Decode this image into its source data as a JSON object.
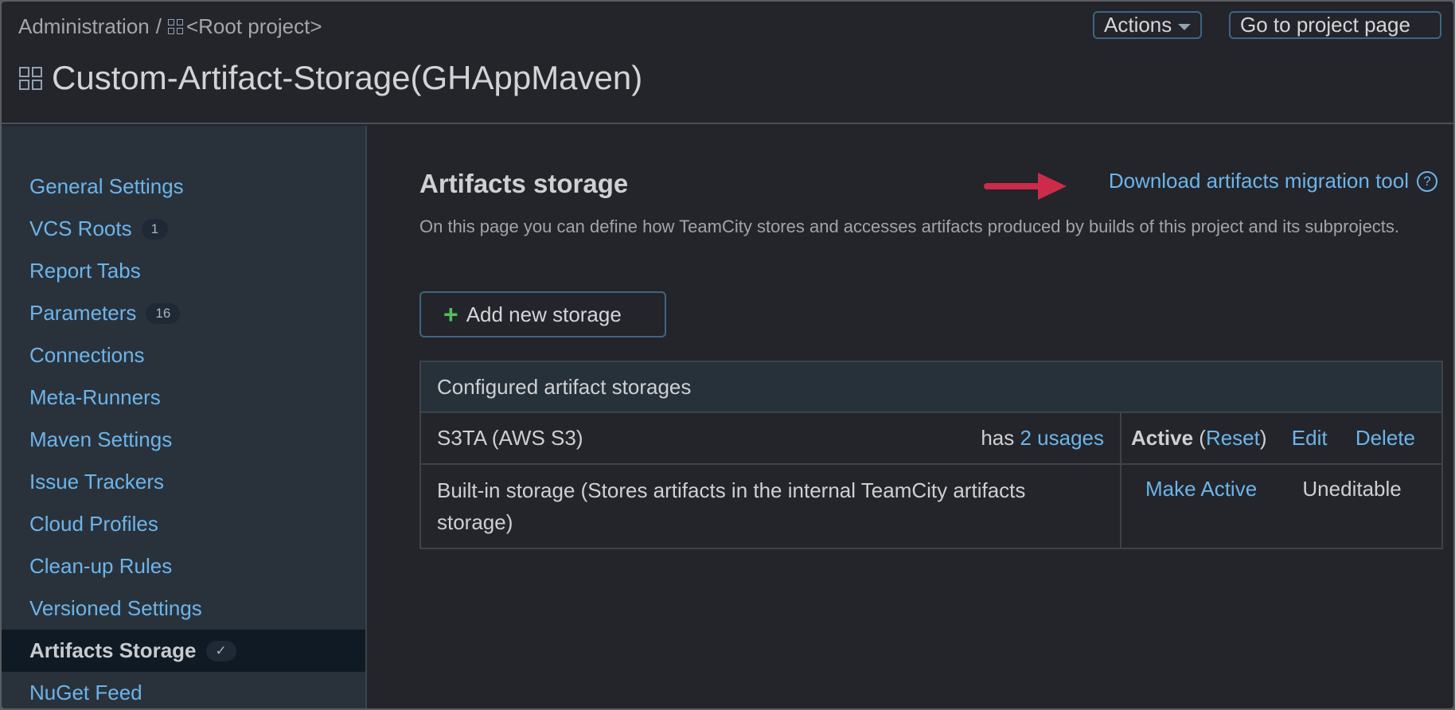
{
  "breadcrumb": {
    "admin": "Administration",
    "sep": "/",
    "root": "<Root project>"
  },
  "title": "Custom-Artifact-Storage(GHAppMaven)",
  "header_buttons": {
    "actions": "Actions",
    "go_to_project": "Go to project page"
  },
  "sidebar": {
    "items": [
      {
        "label": "General Settings"
      },
      {
        "label": "VCS Roots",
        "badge": "1"
      },
      {
        "label": "Report Tabs"
      },
      {
        "label": "Parameters",
        "badge": "16"
      },
      {
        "label": "Connections"
      },
      {
        "label": "Meta-Runners"
      },
      {
        "label": "Maven Settings"
      },
      {
        "label": "Issue Trackers"
      },
      {
        "label": "Cloud Profiles"
      },
      {
        "label": "Clean-up Rules"
      },
      {
        "label": "Versioned Settings"
      },
      {
        "label": "Artifacts Storage",
        "badge": "✓",
        "active": true
      },
      {
        "label": "NuGet Feed"
      }
    ]
  },
  "main": {
    "heading": "Artifacts storage",
    "description": "On this page you can define how TeamCity stores and accesses artifacts produced by builds of this project and its subprojects.",
    "download_link": "Download artifacts migration tool",
    "help": "?",
    "add_button": "Add new storage",
    "add_icon": "+",
    "table": {
      "header": "Configured artifact storages",
      "rows": [
        {
          "name": "S3TA (AWS S3)",
          "usage_prefix": "has",
          "usage_link": "2 usages",
          "status": "Active",
          "reset_open": " (",
          "reset": "Reset",
          "reset_close": ")",
          "edit": "Edit",
          "delete": "Delete"
        },
        {
          "name": "Built-in storage (Stores artifacts in the internal TeamCity artifacts storage)",
          "make_active": "Make Active",
          "uneditable": "Uneditable"
        }
      ]
    }
  },
  "colors": {
    "link": "#6db4ea",
    "arrow": "#cc2b4a",
    "accent_border": "#3e6582"
  }
}
